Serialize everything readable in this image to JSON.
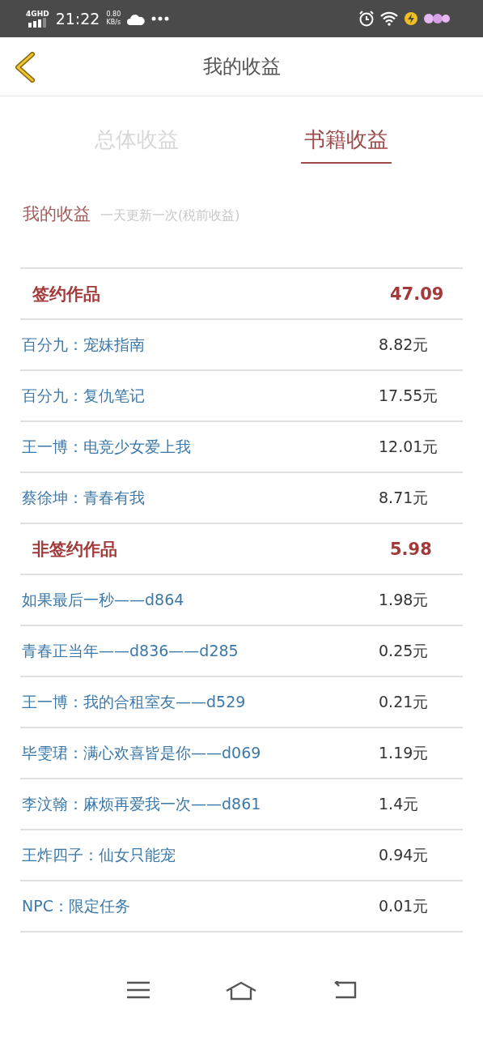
{
  "status_bar": {
    "network": "4G",
    "network_sup": "HD",
    "time": "21:22",
    "speed": "0.80",
    "speed_unit": "KB/s"
  },
  "header": {
    "title": "我的收益"
  },
  "tabs": [
    {
      "label": "总体收益",
      "selected": false
    },
    {
      "label": "书籍收益",
      "selected": true
    }
  ],
  "section": {
    "title": "我的收益",
    "note": "一天更新一次(税前收益)"
  },
  "groups": [
    {
      "title": "签约作品",
      "total": "47.09",
      "rows": [
        {
          "title": "百分九：宠妹指南",
          "amount": "8.82元"
        },
        {
          "title": "百分九：复仇笔记",
          "amount": "17.55元"
        },
        {
          "title": "王一博：电竞少女爱上我",
          "amount": "12.01元"
        },
        {
          "title": "蔡徐坤：青春有我",
          "amount": "8.71元"
        }
      ]
    },
    {
      "title": "非签约作品",
      "total": "5.98",
      "rows": [
        {
          "title": "如果最后一秒——d864",
          "amount": "1.98元"
        },
        {
          "title": "青春正当年——d836——d285",
          "amount": "0.25元"
        },
        {
          "title": "王一博：我的合租室友——d529",
          "amount": "0.21元"
        },
        {
          "title": "毕雯珺：满心欢喜皆是你——d069",
          "amount": "1.19元"
        },
        {
          "title": "李汶翰：麻烦再爱我一次——d861",
          "amount": "1.4元"
        },
        {
          "title": "王炸四子：仙女只能宠",
          "amount": "0.94元"
        },
        {
          "title": "NPC：限定任务",
          "amount": "0.01元"
        }
      ]
    }
  ]
}
